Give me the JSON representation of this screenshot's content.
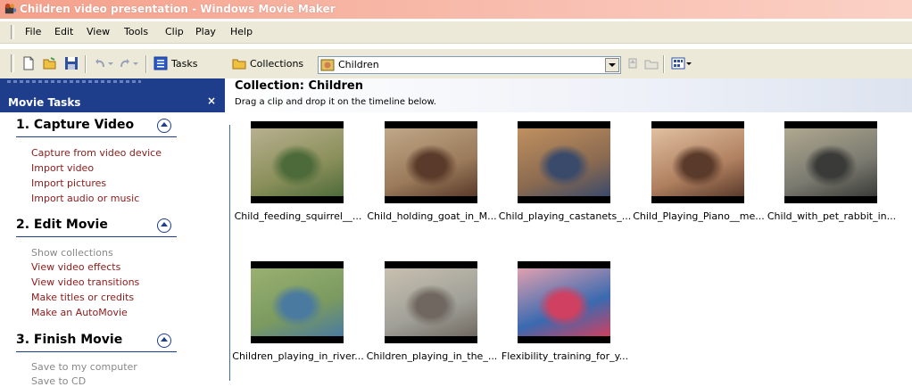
{
  "window": {
    "title": "Children video presentation - Windows Movie Maker"
  },
  "menu": [
    "File",
    "Edit",
    "View",
    "Tools",
    "Clip",
    "Play",
    "Help"
  ],
  "toolbar": {
    "tasks_label": "Tasks",
    "collections_label": "Collections",
    "collection_select": "Children"
  },
  "taskpane": {
    "title": "Movie Tasks",
    "close": "×",
    "sections": [
      {
        "title": "1. Capture Video",
        "links": [
          "Capture from video device",
          "Import video",
          "Import pictures",
          "Import audio or music"
        ]
      },
      {
        "title": "2. Edit Movie",
        "links": [
          "Show collections",
          "View video effects",
          "View video transitions",
          "Make titles or credits",
          "Make an AutoMovie"
        ]
      },
      {
        "title": "3. Finish Movie",
        "links": [
          "Save to my computer",
          "Save to CD"
        ]
      }
    ]
  },
  "collection": {
    "title": "Collection: Children",
    "subtitle": "Drag a clip and drop it on the timeline below.",
    "clips": [
      {
        "name": "Child_feeding_squirrel__...",
        "colors": [
          "#8a8f5a",
          "#4d6b3a",
          "#b8b090"
        ]
      },
      {
        "name": "Child_holding_goat_in_M...",
        "colors": [
          "#9a7a5a",
          "#5a3a2a",
          "#c0a888"
        ]
      },
      {
        "name": "Child_playing_castanets_...",
        "colors": [
          "#8a6a50",
          "#3a4a6a",
          "#c09060"
        ]
      },
      {
        "name": "Child_Playing_Piano__me...",
        "colors": [
          "#b08060",
          "#5a3a2a",
          "#e0c0a0"
        ]
      },
      {
        "name": "Child_with_pet_rabbit_in...",
        "colors": [
          "#7a7a70",
          "#3a3a38",
          "#b0a890"
        ]
      },
      {
        "name": "Children_playing_in_river...",
        "colors": [
          "#7a9a60",
          "#4a7aa0",
          "#9ab070"
        ]
      },
      {
        "name": "Children_playing_in_the_...",
        "colors": [
          "#a0a098",
          "#706860",
          "#c8c0b0"
        ]
      },
      {
        "name": "Flexibility_training_for_y...",
        "colors": [
          "#3a6ab0",
          "#d04060",
          "#e0a0b0"
        ]
      }
    ]
  }
}
